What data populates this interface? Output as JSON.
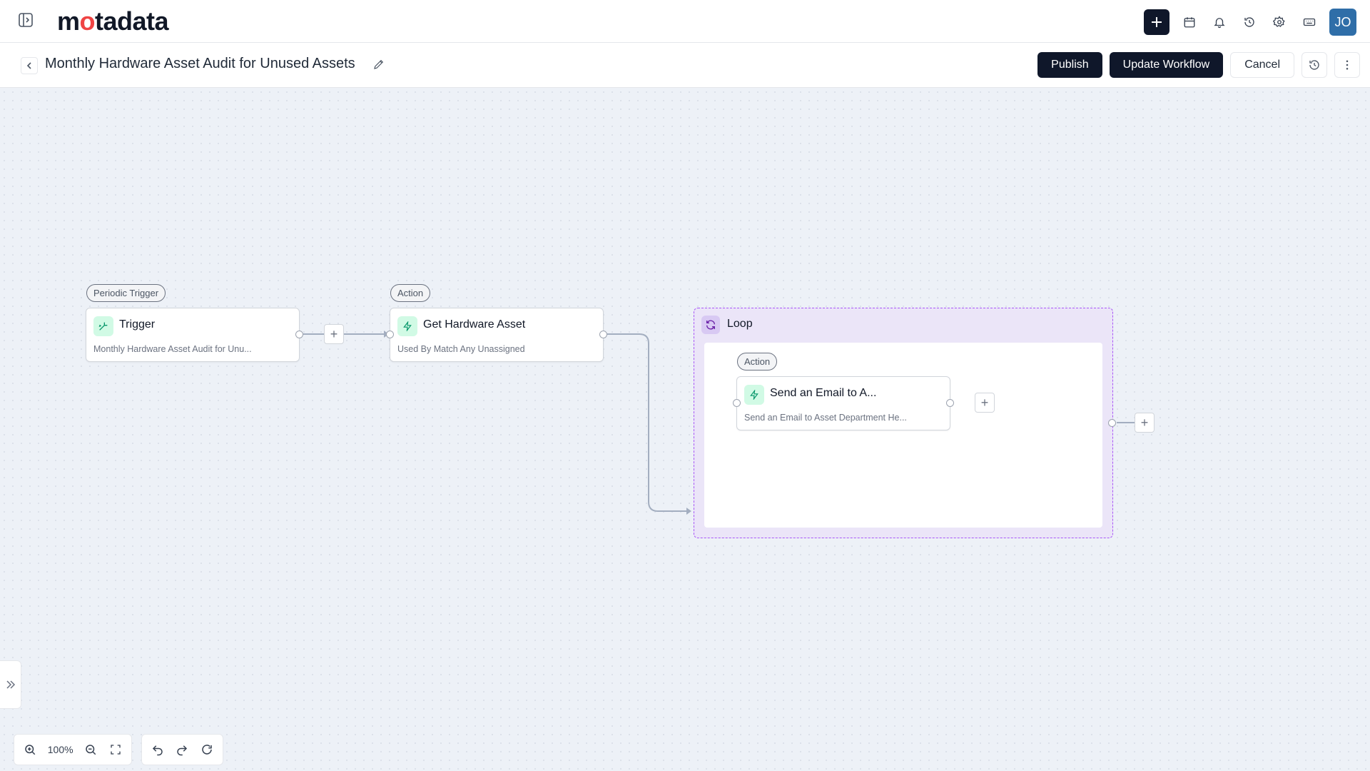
{
  "app": {
    "logo_text_pre": "m",
    "logo_text_dot": "o",
    "logo_text_post": "tadata"
  },
  "header_actions": {
    "avatar_initials": "JO"
  },
  "workflow": {
    "title": "Monthly Hardware Asset Audit for Unused Assets",
    "publish_label": "Publish",
    "update_label": "Update Workflow",
    "cancel_label": "Cancel"
  },
  "nodes": {
    "trigger": {
      "badge": "Periodic Trigger",
      "title": "Trigger",
      "desc": "Monthly Hardware Asset Audit for Unu..."
    },
    "get_asset": {
      "badge": "Action",
      "title": "Get Hardware Asset",
      "desc": "Used By Match Any Unassigned"
    },
    "loop": {
      "title": "Loop"
    },
    "send_email": {
      "badge": "Action",
      "title": "Send an Email to A...",
      "desc": "Send an Email to Asset Department He..."
    }
  },
  "toolbar": {
    "zoom_level": "100%"
  },
  "colors": {
    "accent_dark": "#0f172a",
    "avatar": "#2f6ea8",
    "loop_border": "#a855f7",
    "loop_bg": "#ebe5f8",
    "action_icon_bg": "#d1fae5"
  }
}
